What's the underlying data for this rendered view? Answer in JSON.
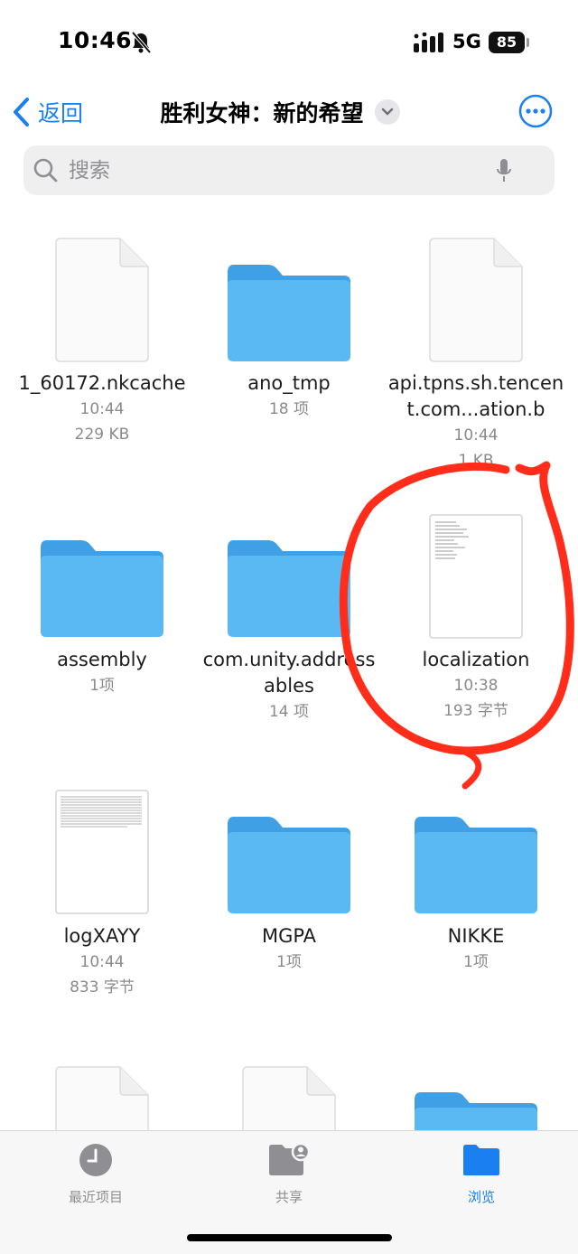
{
  "status_bar": {
    "time": "10:46",
    "network": "5G",
    "battery": "85"
  },
  "nav": {
    "back_label": "返回",
    "title": "胜利女神：新的希望"
  },
  "search": {
    "placeholder": "搜索"
  },
  "items": [
    {
      "type": "document",
      "name": "1_60172.nkcache",
      "time": "10:44",
      "size": "229 KB"
    },
    {
      "type": "folder",
      "name": "ano_tmp",
      "count": "18 项"
    },
    {
      "type": "document",
      "name": "api.tpns.sh.tencent.com...ation.b",
      "time": "10:44",
      "size": "1 KB"
    },
    {
      "type": "folder",
      "name": "assembly",
      "count": "1项"
    },
    {
      "type": "folder",
      "name": "com.unity.addressables",
      "count": "14 项"
    },
    {
      "type": "document-text",
      "name": "localization",
      "time": "10:38",
      "size": "193 字节"
    },
    {
      "type": "document-text",
      "name": "logXAYY",
      "time": "10:44",
      "size": "833 字节"
    },
    {
      "type": "folder",
      "name": "MGPA",
      "count": "1项"
    },
    {
      "type": "folder",
      "name": "NIKKE",
      "count": "1项"
    }
  ],
  "tabs": [
    {
      "label": "最近项目",
      "icon": "clock-icon",
      "active": false
    },
    {
      "label": "共享",
      "icon": "shared-folder-icon",
      "active": false
    },
    {
      "label": "浏览",
      "icon": "folder-icon",
      "active": true
    }
  ],
  "colors": {
    "accent": "#1a7ff0",
    "folder": "#5ab8f2",
    "annotation": "#ff2d1a",
    "inactive_tab": "#8e8e93"
  }
}
